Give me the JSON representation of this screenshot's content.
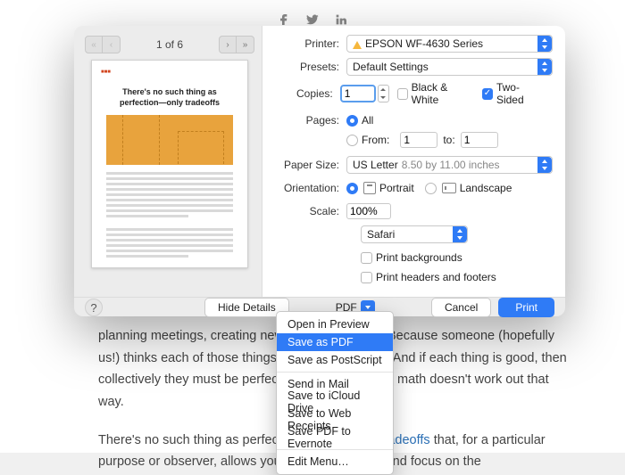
{
  "social": {
    "fb": "facebook-icon",
    "tw": "twitter-icon",
    "li": "linkedin-icon"
  },
  "article": {
    "p1a": "planning meetings, creating new ",
    "p1b": ", writing articles? Because someone (hopefully us!) thinks each of those things is objectively good. And if each thing is good, then collectively they must be perfect? Unfortunately, the math doesn't work out that way.",
    "p2a": "There's no such thing as perfection, only a ",
    "p2link": "set of tradeoffs",
    "p2b": " that, for a particular purpose or observer, allows you to ignore the bad and focus on the"
  },
  "preview": {
    "page_of": "1 of 6",
    "thumb_title": "There's no such thing as perfection—only tradeoffs"
  },
  "print": {
    "printer_lab": "Printer:",
    "printer_val": "EPSON WF-4630 Series",
    "presets_lab": "Presets:",
    "presets_val": "Default Settings",
    "copies_lab": "Copies:",
    "copies_val": "1",
    "bw": "Black & White",
    "two_sided": "Two-Sided",
    "pages_lab": "Pages:",
    "all": "All",
    "from": "From:",
    "from_v": "1",
    "to": "to:",
    "to_v": "1",
    "paper_lab": "Paper Size:",
    "paper_val": "US Letter",
    "paper_sub": "8.50 by 11.00 inches",
    "orient_lab": "Orientation:",
    "portrait": "Portrait",
    "landscape": "Landscape",
    "scale_lab": "Scale:",
    "scale_val": "100%",
    "app_val": "Safari",
    "print_bg": "Print backgrounds",
    "print_hf": "Print headers and footers"
  },
  "footer": {
    "hide": "Hide Details",
    "pdf": "PDF",
    "cancel": "Cancel",
    "print": "Print"
  },
  "menu": {
    "items": [
      "Open in Preview",
      "Save as PDF",
      "Save as PostScript",
      "Send in Mail",
      "Save to iCloud Drive",
      "Save to Web Receipts",
      "Save PDF to Evernote",
      "Edit Menu…"
    ],
    "selected_index": 1
  }
}
